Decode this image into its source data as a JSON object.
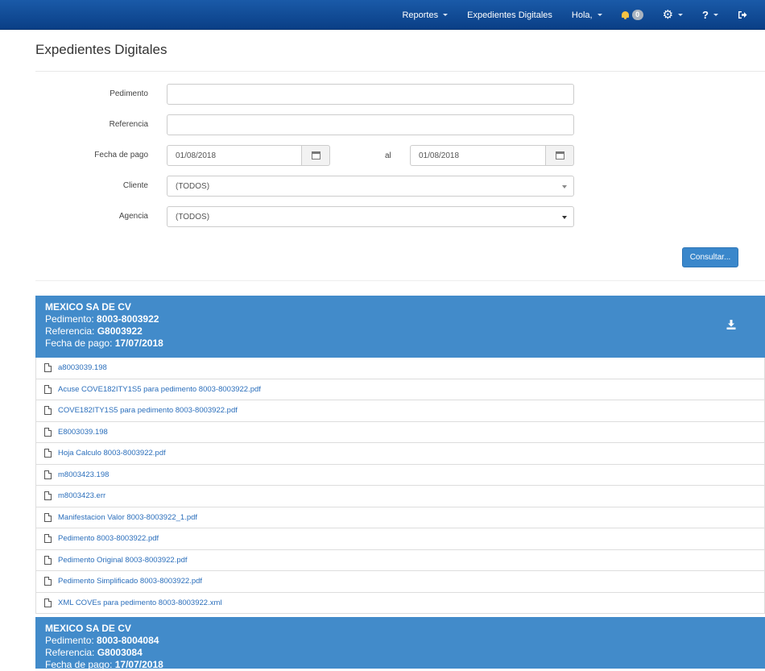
{
  "navbar": {
    "reportes": "Reportes",
    "expedientes": "Expedientes Digitales",
    "hola": "Hola,",
    "notifications_count": "0",
    "help": "?"
  },
  "page": {
    "title": "Expedientes Digitales"
  },
  "form": {
    "pedimento_label": "Pedimento",
    "pedimento_value": "",
    "referencia_label": "Referencia",
    "referencia_value": "",
    "fecha_label": "Fecha de pago",
    "fecha_from": "01/08/2018",
    "al_label": "al",
    "fecha_to": "01/08/2018",
    "cliente_label": "Cliente",
    "cliente_value": "(TODOS)",
    "agencia_label": "Agencia",
    "agencia_value": "(TODOS)",
    "submit_label": "Consultar..."
  },
  "results": [
    {
      "company": "MEXICO SA DE CV",
      "pedimento_label": "Pedimento:",
      "pedimento": "8003-8003922",
      "referencia_label": "Referencia:",
      "referencia": "G8003922",
      "fecha_label": "Fecha de pago:",
      "fecha": "17/07/2018",
      "files": [
        "a8003039.198",
        "Acuse COVE182ITY1S5 para pedimento 8003-8003922.pdf",
        "COVE182ITY1S5 para pedimento 8003-8003922.pdf",
        "E8003039.198",
        "Hoja Calculo 8003-8003922.pdf",
        "m8003423.198",
        "m8003423.err",
        "Manifestacion Valor 8003-8003922_1.pdf",
        "Pedimento 8003-8003922.pdf",
        "Pedimento Original 8003-8003922.pdf",
        "Pedimento Simplificado 8003-8003922.pdf",
        "XML COVEs para pedimento 8003-8003922.xml"
      ]
    },
    {
      "company": "MEXICO SA DE CV",
      "pedimento_label": "Pedimento:",
      "pedimento": "8003-8004084",
      "referencia_label": "Referencia:",
      "referencia": "G8003084",
      "fecha_label": "Fecha de pago:",
      "fecha": "17/07/2018"
    }
  ],
  "colors": {
    "navbar": "#0f4c97",
    "panel_header": "#428bca",
    "link": "#2a6ebb",
    "button": "#3a87cb"
  }
}
